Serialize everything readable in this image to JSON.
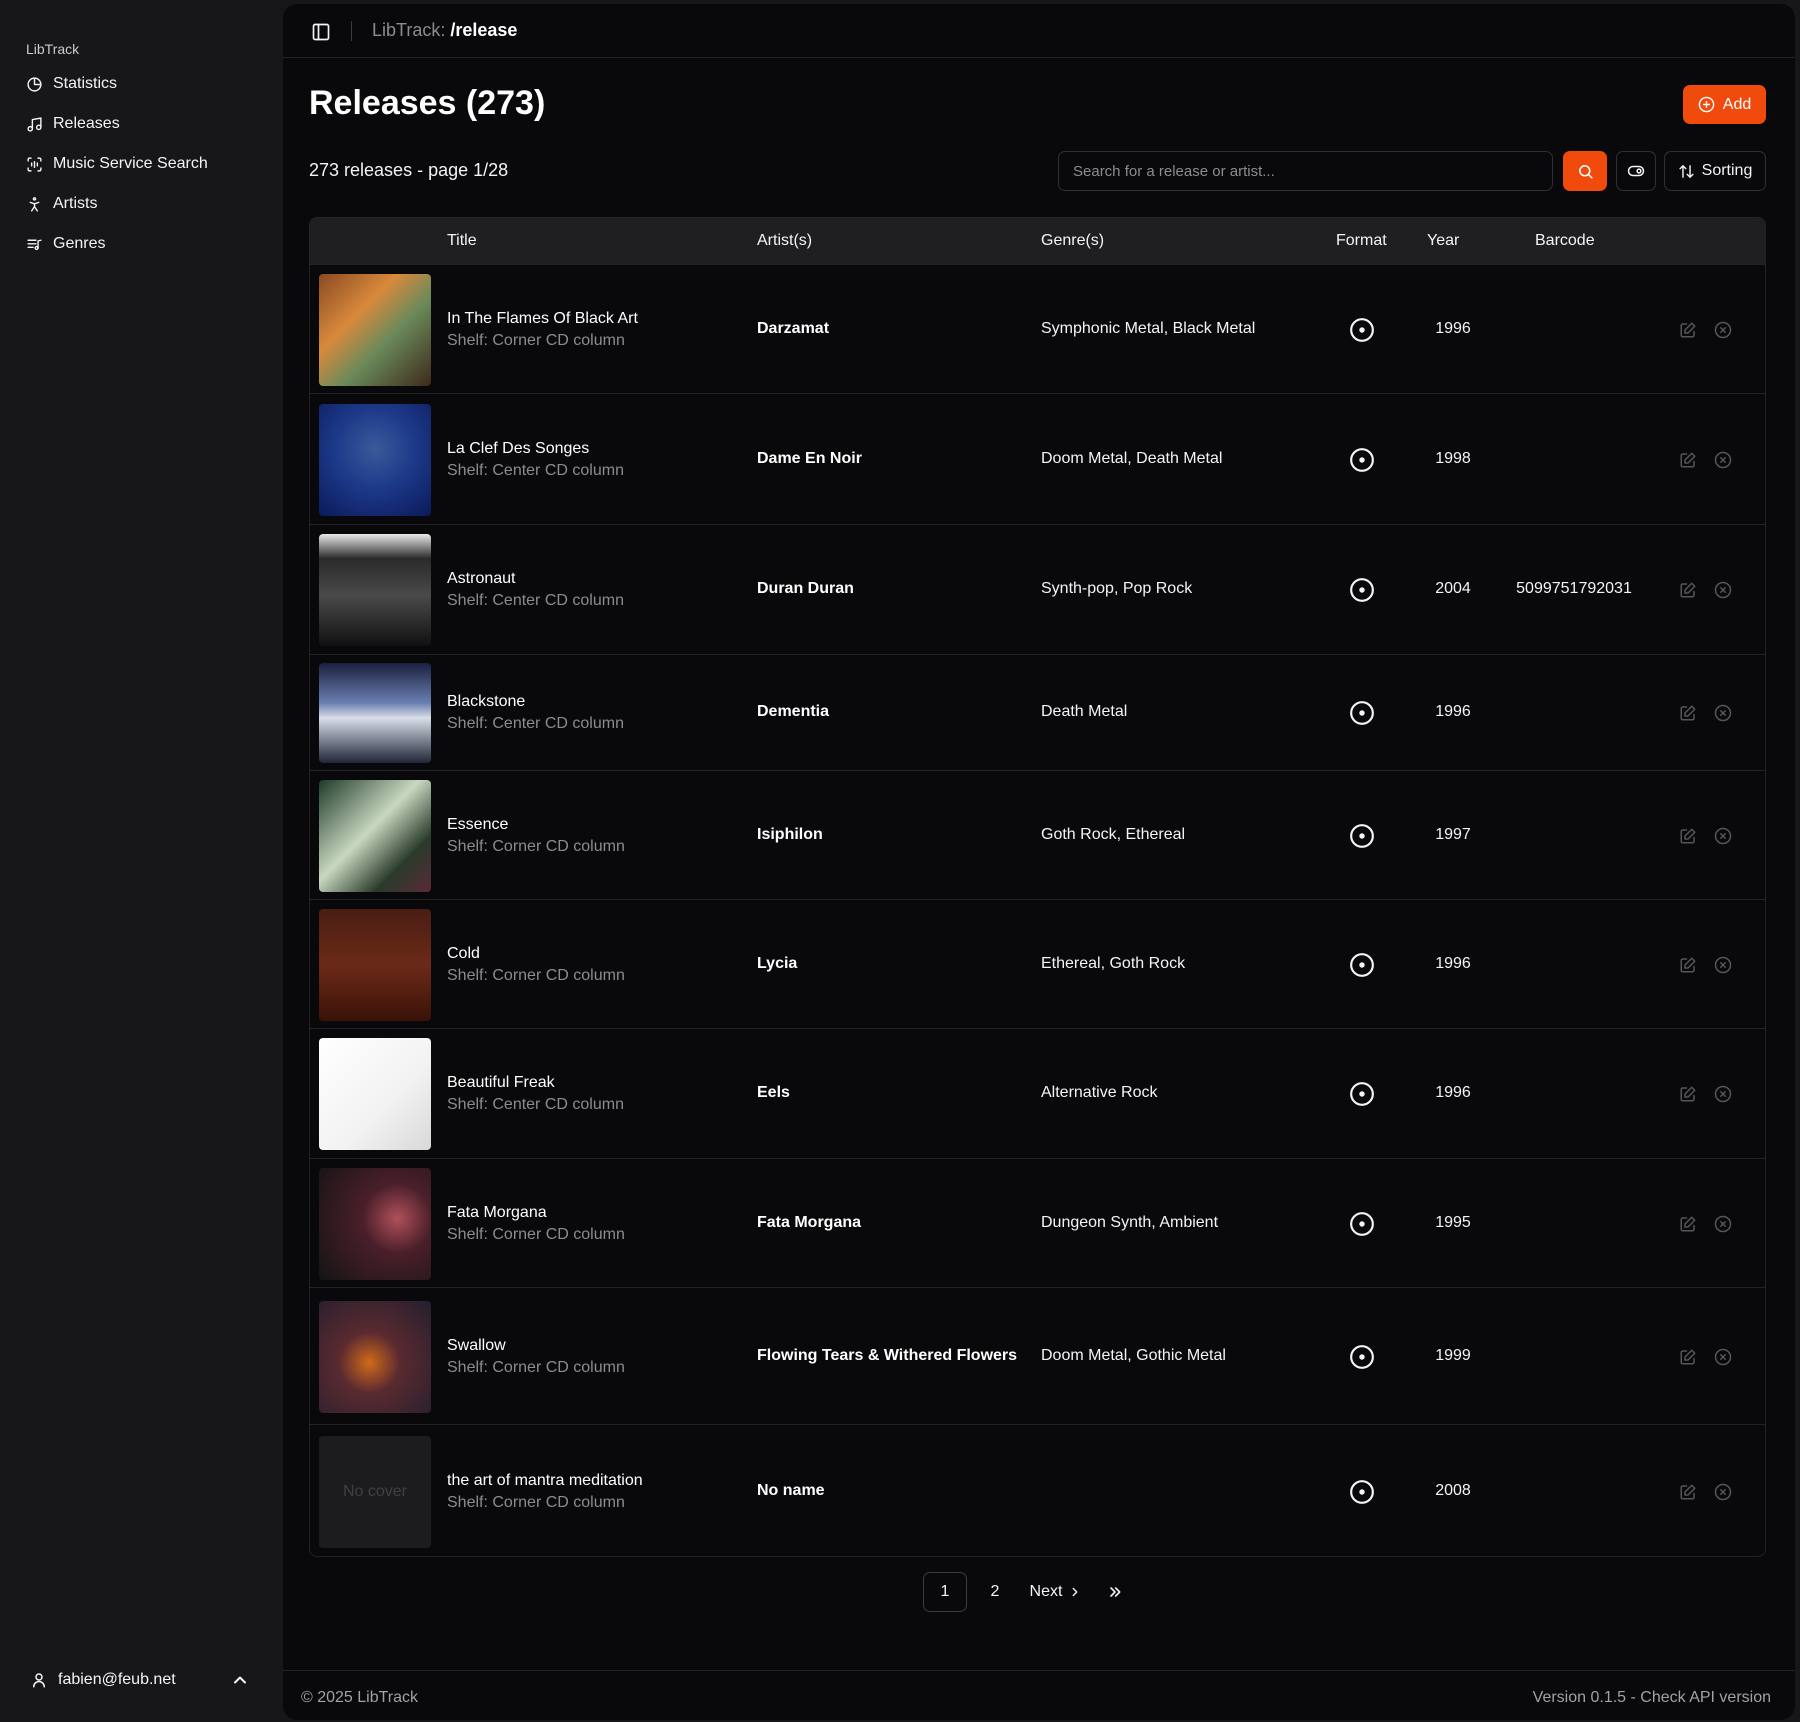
{
  "sidebar": {
    "brand": "LibTrack",
    "items": [
      {
        "label": "Statistics",
        "icon": "pie-chart-icon"
      },
      {
        "label": "Releases",
        "icon": "music-note-icon"
      },
      {
        "label": "Music Service Search",
        "icon": "scan-audio-icon"
      },
      {
        "label": "Artists",
        "icon": "person-icon"
      },
      {
        "label": "Genres",
        "icon": "list-music-icon"
      }
    ],
    "user": "fabien@feub.net"
  },
  "topbar": {
    "breadcrumb_prefix": "LibTrack: ",
    "breadcrumb_current": "/release"
  },
  "page": {
    "title": "Releases (273)",
    "add_label": "Add",
    "count_text": "273 releases - page 1/28",
    "search_placeholder": "Search for a release or artist...",
    "sorting_label": "Sorting"
  },
  "table": {
    "headers": {
      "title": "Title",
      "artists": "Artist(s)",
      "genres": "Genre(s)",
      "format": "Format",
      "year": "Year",
      "barcode": "Barcode"
    },
    "rows": [
      {
        "title": "In The Flames Of Black Art",
        "shelf": "Shelf: Corner CD column",
        "artist": "Darzamat",
        "genres": "Symphonic Metal, Black Metal",
        "year": "1996",
        "barcode": "",
        "format": "cd-icon"
      },
      {
        "title": "La Clef Des Songes",
        "shelf": "Shelf: Center CD column",
        "artist": "Dame En Noir",
        "genres": "Doom Metal, Death Metal",
        "year": "1998",
        "barcode": "",
        "format": "cd-icon"
      },
      {
        "title": "Astronaut",
        "shelf": "Shelf: Center CD column",
        "artist": "Duran Duran",
        "genres": "Synth-pop, Pop Rock",
        "year": "2004",
        "barcode": "5099751792031",
        "format": "cd-icon"
      },
      {
        "title": "Blackstone",
        "shelf": "Shelf: Center CD column",
        "artist": "Dementia",
        "genres": "Death Metal",
        "year": "1996",
        "barcode": "",
        "format": "cd-icon"
      },
      {
        "title": "Essence",
        "shelf": "Shelf: Corner CD column",
        "artist": "Isiphilon",
        "genres": "Goth Rock, Ethereal",
        "year": "1997",
        "barcode": "",
        "format": "cd-icon"
      },
      {
        "title": "Cold",
        "shelf": "Shelf: Corner CD column",
        "artist": "Lycia",
        "genres": "Ethereal, Goth Rock",
        "year": "1996",
        "barcode": "",
        "format": "cd-icon"
      },
      {
        "title": "Beautiful Freak",
        "shelf": "Shelf: Center CD column",
        "artist": "Eels",
        "genres": "Alternative Rock",
        "year": "1996",
        "barcode": "",
        "format": "cd-icon"
      },
      {
        "title": "Fata Morgana",
        "shelf": "Shelf: Corner CD column",
        "artist": "Fata Morgana",
        "genres": "Dungeon Synth, Ambient",
        "year": "1995",
        "barcode": "",
        "format": "cd-icon"
      },
      {
        "title": "Swallow",
        "shelf": "Shelf: Corner CD column",
        "artist": "Flowing Tears & Withered Flowers",
        "genres": "Doom Metal, Gothic Metal",
        "year": "1999",
        "barcode": "",
        "format": "cd-icon"
      },
      {
        "title": "the art of mantra meditation",
        "shelf": "Shelf: Corner CD column",
        "artist": "No name",
        "genres": "",
        "year": "2008",
        "barcode": "",
        "format": "cd-icon",
        "no_cover_text": "No cover"
      }
    ]
  },
  "pagination": {
    "pages": [
      "1",
      "2"
    ],
    "current": "1",
    "next_label": "Next",
    "last_icon": "double-chevron-right-icon"
  },
  "footer": {
    "copyright": "© 2025 LibTrack",
    "version": "Version 0.1.5 - Check API version"
  },
  "colors": {
    "accent": "#f04a0c",
    "background": "#09090b",
    "sidebar": "#17171a"
  }
}
